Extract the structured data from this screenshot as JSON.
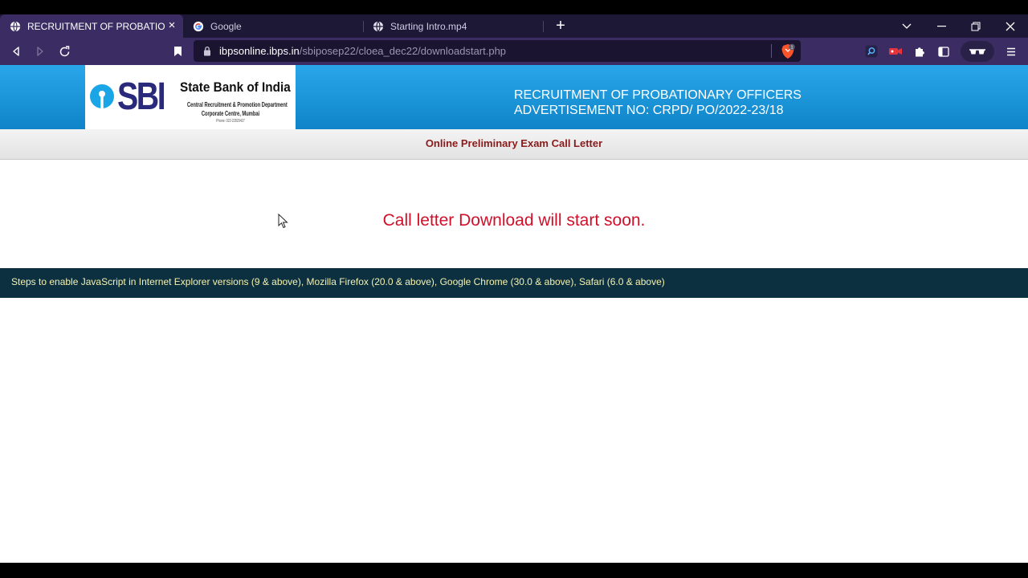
{
  "browser": {
    "tabs": [
      {
        "title": "RECRUITMENT OF PROBATIONAR",
        "active": true,
        "icon": "globe-icon"
      },
      {
        "title": "Google",
        "active": false,
        "icon": "google-icon"
      },
      {
        "title": "Starting Intro.mp4",
        "active": false,
        "icon": "globe-icon"
      }
    ],
    "address": {
      "host": "ibpsonline.ibps.in",
      "path": "/sbiposep22/cloea_dec22/downloadstart.php"
    },
    "shield_count": "1"
  },
  "banner": {
    "logo": {
      "mark": "SBI",
      "bank_name": "State Bank of India",
      "dept_line": "Central Recruitment & Promotion Department",
      "office_line": "Corporate Centre, Mumbai",
      "phone_line": "Phone: 022-22820427"
    },
    "title_line1": "RECRUITMENT OF PROBATIONARY OFFICERS",
    "title_line2": "ADVERTISEMENT NO: CRPD/ PO/2022-23/18"
  },
  "subheader": "Online Preliminary Exam Call Letter",
  "message": "Call letter Download will start soon.",
  "footer_link": "Steps to enable JavaScript in Internet Explorer versions (9 & above), Mozilla Firefox (20.0 & above), Google Chrome (30.0 & above), Safari (6.0 & above)",
  "colors": {
    "banner_blue": "#1a92d6",
    "browser_purple": "#3b2d63",
    "message_red": "#d0102a",
    "subheader_maroon": "#8b1a1a",
    "jsbar_bg": "#0d3040"
  }
}
